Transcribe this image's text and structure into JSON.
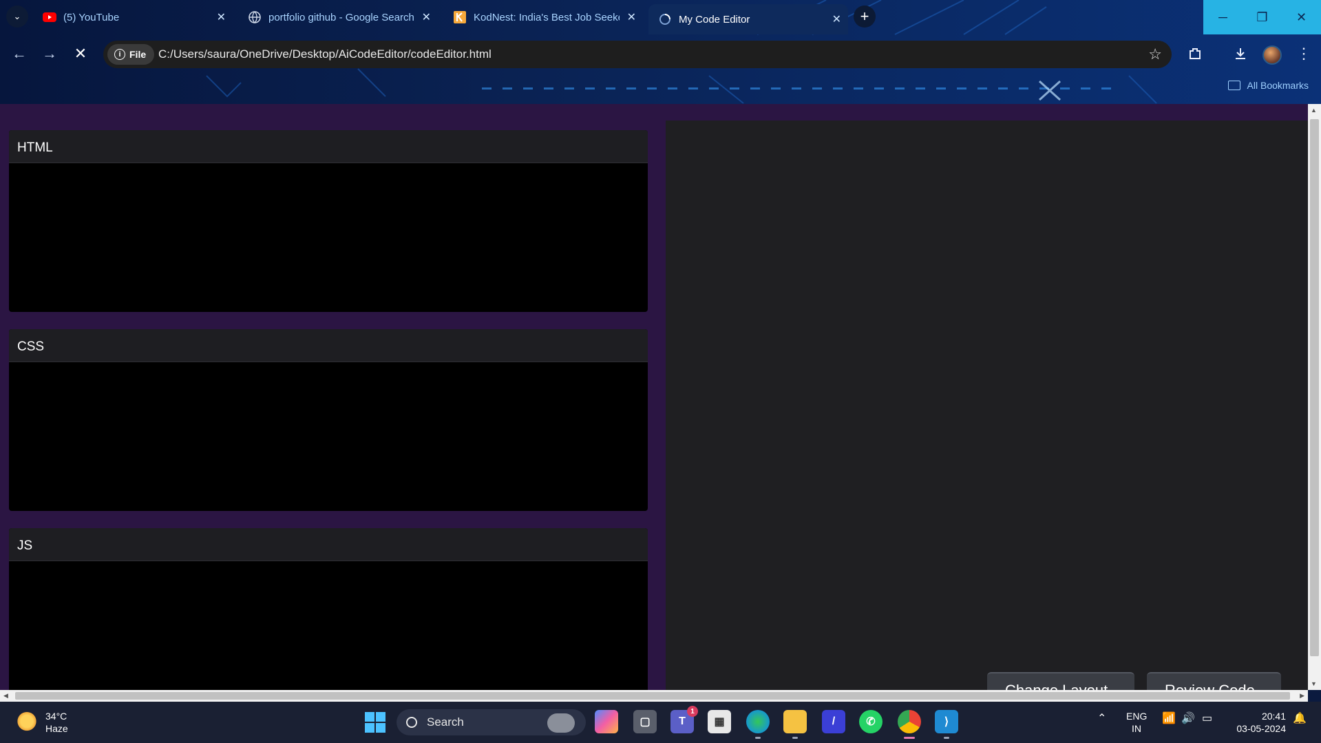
{
  "browser": {
    "tabs": [
      {
        "title": "(5) YouTube",
        "icon": "youtube-icon",
        "active": false
      },
      {
        "title": "portfolio github - Google Search",
        "icon": "globe-icon",
        "active": false
      },
      {
        "title": "KodNest: India's Best Job Seeker",
        "icon": "kodnest-icon",
        "active": false
      },
      {
        "title": "My Code Editor",
        "icon": "loading-icon",
        "active": true
      }
    ],
    "tab_close": "✕",
    "new_tab": "+",
    "address": {
      "chip_label": "File",
      "url": "C:/Users/saura/OneDrive/Desktop/AiCodeEditor/codeEditor.html"
    },
    "bookmarks_label": "All Bookmarks"
  },
  "editor": {
    "panels": [
      {
        "label": "HTML"
      },
      {
        "label": "CSS"
      },
      {
        "label": "JS"
      }
    ],
    "buttons": {
      "change_layout": "Change Layout",
      "review_code": "Review Code"
    }
  },
  "taskbar": {
    "weather": {
      "temp": "34°C",
      "condition": "Haze"
    },
    "search_label": "Search",
    "teams_badge": "1",
    "language": {
      "line1": "ENG",
      "line2": "IN"
    },
    "clock": {
      "time": "20:41",
      "date": "03-05-2024"
    }
  },
  "colors": {
    "page_background": "#2b1543",
    "panel_header": "#1e1e22",
    "editor_body": "#000000",
    "preview_background": "#1f1f22",
    "accent": "#27b3e4"
  }
}
